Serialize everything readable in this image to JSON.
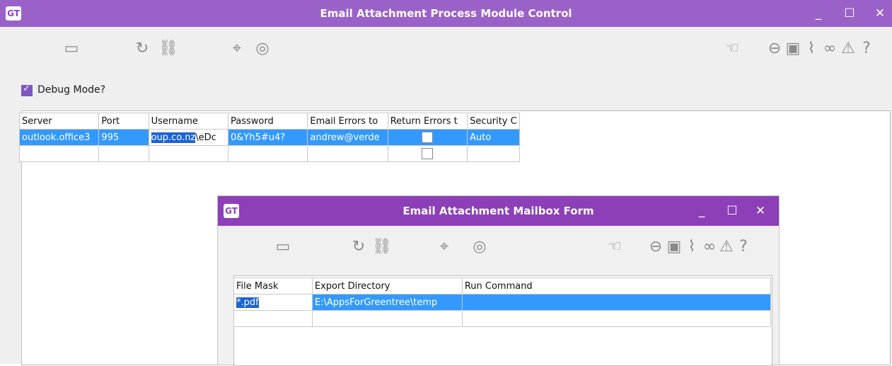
{
  "main_window": {
    "logo": "GT",
    "title": "Email Attachment Process Module Control",
    "controls": {
      "minimize": "_",
      "maximize": "☐",
      "close": "✕"
    },
    "toolbar_left": [
      {
        "name": "save-icon",
        "glyph": "▭"
      },
      {
        "name": "refresh-icon",
        "glyph": "↻"
      },
      {
        "name": "link-nodes-icon",
        "glyph": "⛓"
      },
      {
        "name": "binoculars-icon",
        "glyph": "⌖"
      },
      {
        "name": "compass-icon",
        "glyph": "◎"
      }
    ],
    "toolbar_right": [
      {
        "name": "pointer-icon",
        "glyph": "☜"
      },
      {
        "name": "back-icon",
        "glyph": "⊖"
      },
      {
        "name": "document-icon",
        "glyph": "▣"
      },
      {
        "name": "attach-icon",
        "glyph": "⌇"
      },
      {
        "name": "chain-icon",
        "glyph": "∞"
      },
      {
        "name": "warning-icon",
        "glyph": "⚠"
      },
      {
        "name": "help-icon",
        "glyph": "?"
      }
    ],
    "debug_checkbox": {
      "label": "Debug Mode?",
      "checked": true
    },
    "grid": {
      "columns": [
        "Server",
        "Port",
        "Username",
        "Password",
        "Email Errors to",
        "Return Errors t",
        "Security C"
      ],
      "rows": [
        {
          "server": "outlook.office3",
          "port": "995",
          "username_hl": "oup.co.nz",
          "username_rest": "\\eDc",
          "password": "0&Yh5#u4?",
          "email_errors_to": "andrew@verde",
          "return_errors": false,
          "security": "Auto"
        },
        {
          "server": "",
          "port": "",
          "username_hl": "",
          "username_rest": "",
          "password": "",
          "email_errors_to": "",
          "return_errors": false,
          "security": ""
        }
      ]
    }
  },
  "sub_window": {
    "logo": "GT",
    "title": "Email Attachment Mailbox Form",
    "controls": {
      "minimize": "_",
      "maximize": "☐",
      "close": "✕"
    },
    "grid": {
      "columns": [
        "File Mask",
        "Export Directory",
        "Run Command"
      ],
      "rows": [
        {
          "file_mask": "*.pdf",
          "export_directory": "E:\\AppsForGreentree\\temp",
          "run_command": ""
        },
        {
          "file_mask": "",
          "export_directory": "",
          "run_command": ""
        }
      ]
    }
  },
  "colors": {
    "main_titlebar": "#9a62c8",
    "sub_titlebar": "#8c3fb7",
    "selection": "#3399ff",
    "checkbox_accent": "#7e57c2"
  }
}
